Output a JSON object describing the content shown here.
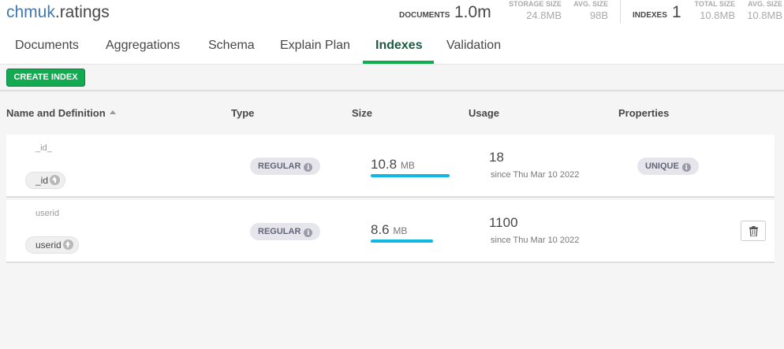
{
  "header": {
    "namespace_db": "chmuk",
    "namespace_coll": ".ratings",
    "documents_label": "DOCUMENTS",
    "documents_value": "1.0m",
    "storage_size_label": "STORAGE SIZE",
    "storage_size_value": "24.8MB",
    "avg_size_label": "AVG. SIZE",
    "avg_size_value": "98B",
    "indexes_label": "INDEXES",
    "indexes_value": "1",
    "total_size_label": "TOTAL SIZE",
    "total_size_value": "10.8MB",
    "idx_avg_size_label": "AVG. SIZE",
    "idx_avg_size_value": "10.8MB"
  },
  "tabs": [
    {
      "label": "Documents"
    },
    {
      "label": "Aggregations"
    },
    {
      "label": "Schema"
    },
    {
      "label": "Explain Plan"
    },
    {
      "label": "Indexes"
    },
    {
      "label": "Validation"
    }
  ],
  "active_tab": "Indexes",
  "toolbar": {
    "create_index_label": "CREATE INDEX"
  },
  "columns": {
    "name": "Name and Definition",
    "type": "Type",
    "size": "Size",
    "usage": "Usage",
    "properties": "Properties"
  },
  "indexes": [
    {
      "name": "_id_",
      "field": "_id",
      "type": "REGULAR",
      "size_value": "10.8",
      "size_unit": "MB",
      "size_fraction": 1.0,
      "usage_count": "18",
      "usage_since": "since Thu Mar 10 2022",
      "property": "UNIQUE"
    },
    {
      "name": "userid",
      "field": "userid",
      "type": "REGULAR",
      "size_value": "8.6",
      "size_unit": "MB",
      "size_fraction": 0.79,
      "usage_count": "1100",
      "usage_since": "since Thu Mar 10 2022",
      "property": ""
    }
  ],
  "colors": {
    "accent_green": "#13aa52",
    "active_tab_text": "#1e5a43",
    "size_bar": "#10b7e3",
    "namespace_db": "#3d79b4"
  },
  "icons": {
    "sort": "sort-ascending-icon",
    "field_direction": "arrow-up-circle-icon",
    "info": "info-icon",
    "delete": "trash-icon"
  }
}
